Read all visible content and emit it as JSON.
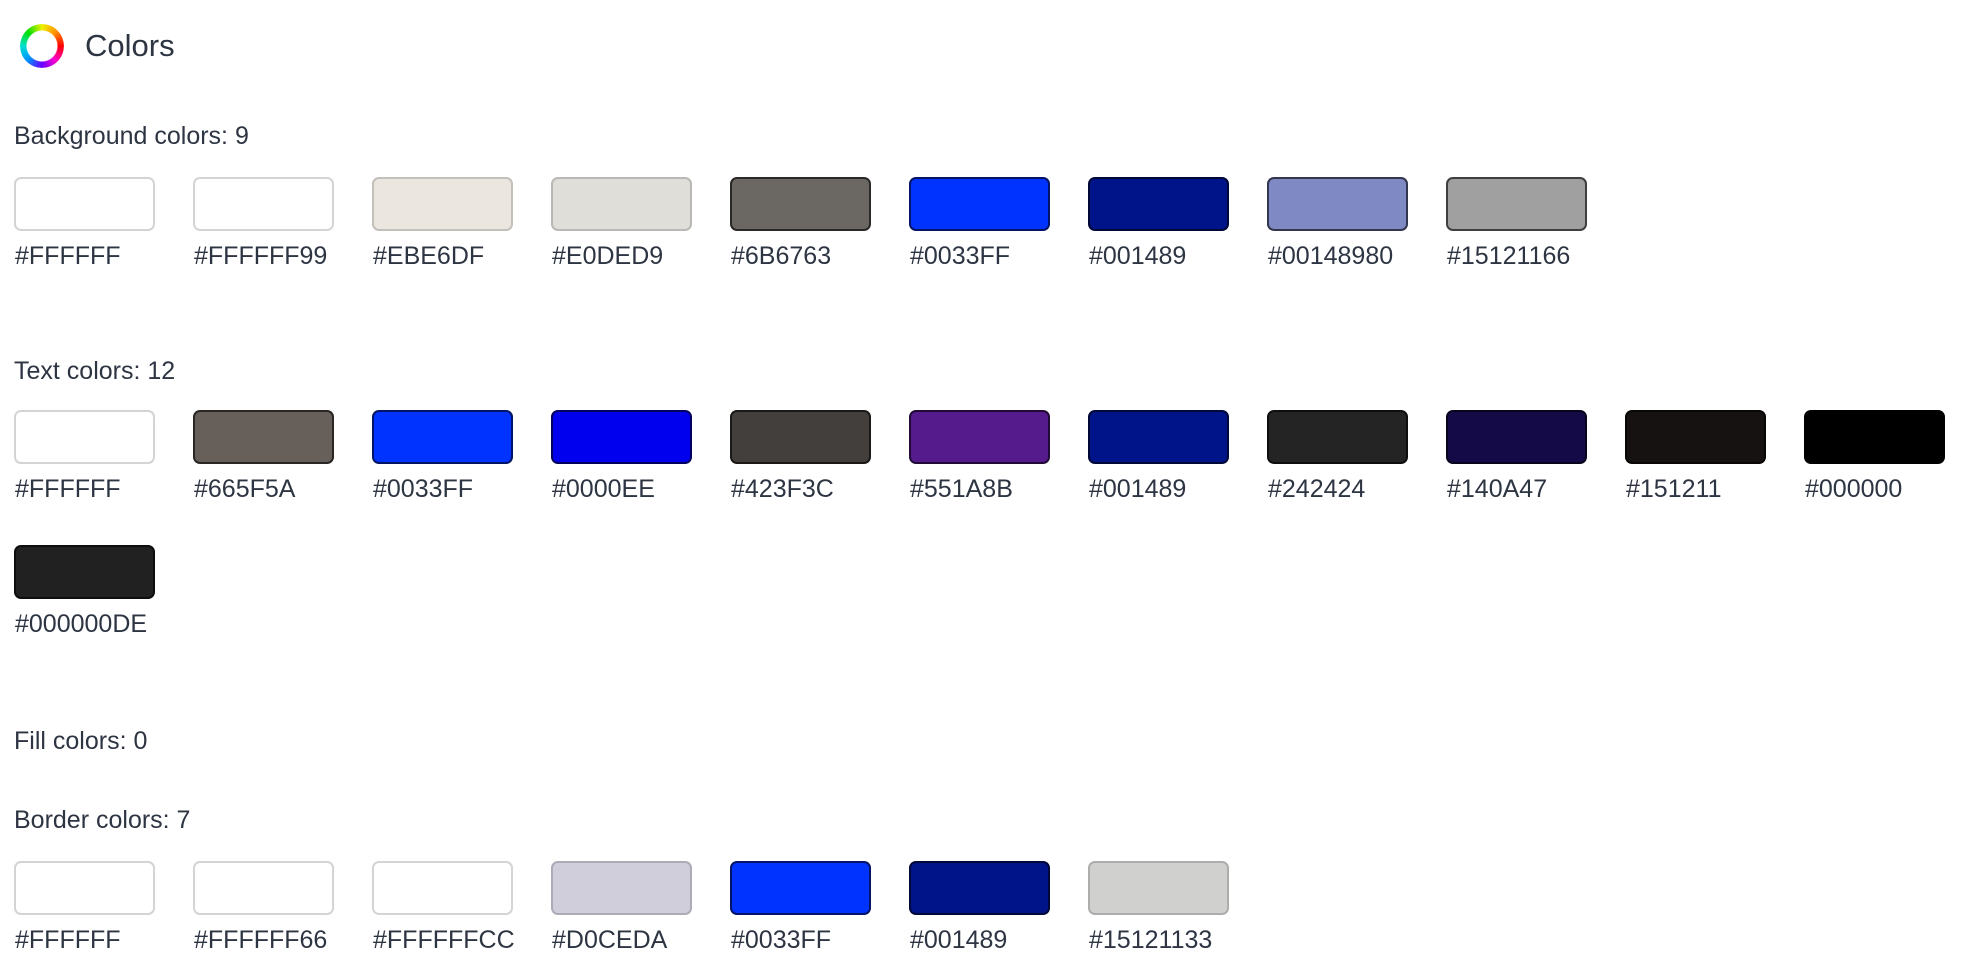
{
  "header": {
    "title": "Colors",
    "icon": "color-wheel-icon"
  },
  "sections": [
    {
      "key": "background",
      "title": "Background colors: 9",
      "colors": [
        "#FFFFFF",
        "#FFFFFF99",
        "#EBE6DF",
        "#E0DED9",
        "#6B6763",
        "#0033FF",
        "#001489",
        "#00148980",
        "#15121166"
      ]
    },
    {
      "key": "text",
      "title": "Text colors: 12",
      "colors": [
        "#FFFFFF",
        "#665F5A",
        "#0033FF",
        "#0000EE",
        "#423F3C",
        "#551A8B",
        "#001489",
        "#242424",
        "#140A47",
        "#151211",
        "#000000",
        "#000000DE"
      ]
    },
    {
      "key": "fill",
      "title": "Fill colors: 0",
      "colors": []
    },
    {
      "key": "border",
      "title": "Border colors: 7",
      "colors": [
        "#FFFFFF",
        "#FFFFFF66",
        "#FFFFFFCC",
        "#D0CEDA",
        "#0033FF",
        "#001489",
        "#15121133"
      ]
    }
  ]
}
